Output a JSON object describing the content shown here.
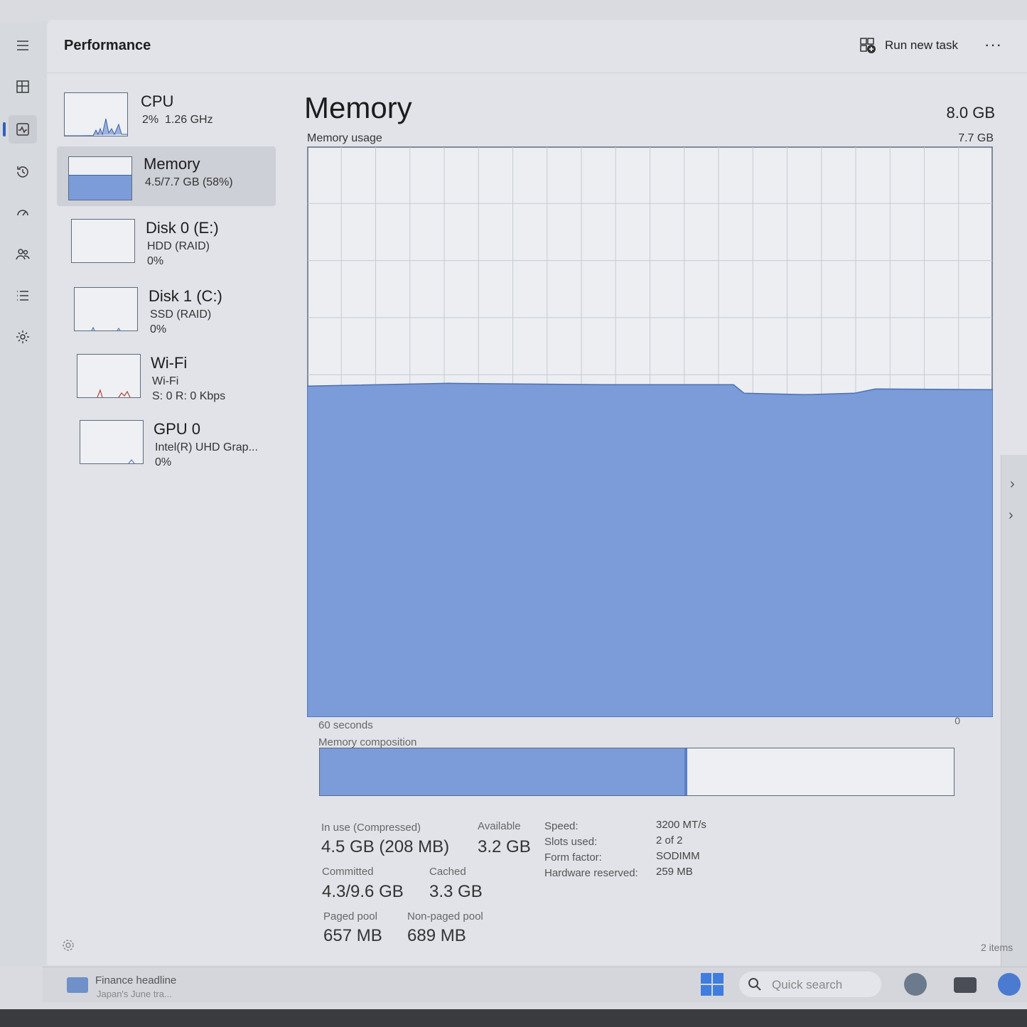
{
  "window": {
    "title": "Performance",
    "run_new_task": "Run new task",
    "more": "···"
  },
  "rail": {
    "items": [
      {
        "id": "menu",
        "icon": "hamburger-icon"
      },
      {
        "id": "processes",
        "icon": "processes-icon"
      },
      {
        "id": "performance",
        "icon": "performance-icon",
        "active": true
      },
      {
        "id": "app-history",
        "icon": "history-icon"
      },
      {
        "id": "startup",
        "icon": "startup-icon"
      },
      {
        "id": "users",
        "icon": "users-icon"
      },
      {
        "id": "details",
        "icon": "details-icon"
      },
      {
        "id": "services",
        "icon": "services-icon"
      }
    ]
  },
  "devices": [
    {
      "name": "CPU",
      "sub": "2%  1.26 GHz"
    },
    {
      "name": "Memory",
      "sub": "4.5/7.7 GB (58%)"
    },
    {
      "name": "Disk 0 (E:)",
      "sub": "HDD (RAID)\n0%"
    },
    {
      "name": "Disk 1 (C:)",
      "sub": "SSD (RAID)\n0%"
    },
    {
      "name": "Wi-Fi",
      "sub": "Wi-Fi\nS: 0 R: 0 Kbps"
    },
    {
      "name": "GPU 0",
      "sub": "Intel(R) UHD Grap...\n0%"
    }
  ],
  "memory": {
    "heading": "Memory",
    "total": "8.0 GB",
    "usage_label": "Memory usage",
    "usage_max": "7.7 GB",
    "axis_left": "60 seconds",
    "axis_right": "0",
    "composition_label": "Memory composition",
    "composition_used_fraction": 0.58,
    "usage_fraction": 0.58,
    "stats": {
      "in_use_label": "In use (Compressed)",
      "in_use_value": "4.5 GB (208 MB)",
      "available_label": "Available",
      "available_value": "3.2 GB",
      "committed_label": "Committed",
      "committed_value": "4.3/9.6 GB",
      "cached_label": "Cached",
      "cached_value": "3.3 GB",
      "paged_label": "Paged pool",
      "paged_value": "657 MB",
      "nonpaged_label": "Non-paged pool",
      "nonpaged_value": "689 MB"
    },
    "specs": {
      "speed_label": "Speed:",
      "speed_value": "3200 MT/s",
      "slots_label": "Slots used:",
      "slots_value": "2 of 2",
      "form_label": "Form factor:",
      "form_value": "SODIMM",
      "hw_label": "Hardware reserved:",
      "hw_value": "259 MB"
    }
  },
  "status": {
    "items_count": "2 items"
  },
  "taskbar": {
    "widget_title": "Finance headline",
    "widget_sub": "Japan's June tra...",
    "search_placeholder": "Quick search"
  },
  "colors": {
    "accent": "#2f5fbf",
    "memory_fill": "#7b9cd9",
    "memory_line": "#4a6fb5",
    "grid": "#c5cad3"
  }
}
